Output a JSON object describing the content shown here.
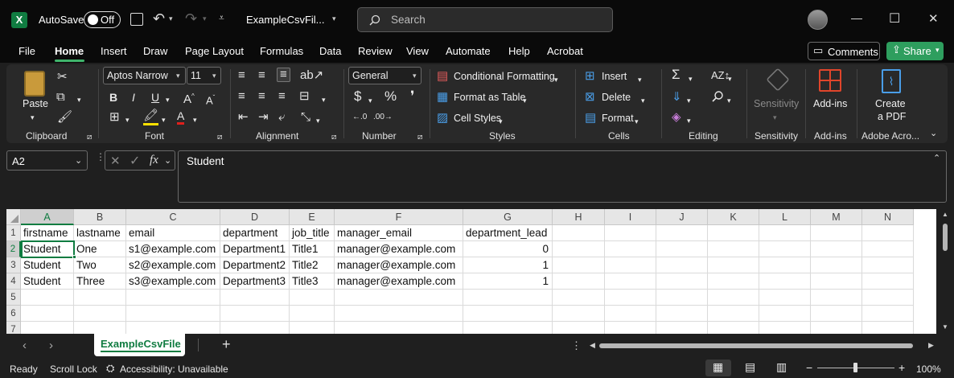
{
  "title": {
    "autosave_label": "AutoSave",
    "autosave_state": "Off",
    "filename": "ExampleCsvFil...",
    "search_placeholder": "Search",
    "minimize": "—",
    "maximize": "☐",
    "close": "✕"
  },
  "menu": {
    "tabs": [
      "File",
      "Home",
      "Insert",
      "Draw",
      "Page Layout",
      "Formulas",
      "Data",
      "Review",
      "View",
      "Automate",
      "Help",
      "Acrobat"
    ],
    "active": "Home",
    "comments": "Comments",
    "share": "Share"
  },
  "ribbon": {
    "clipboard": {
      "paste": "Paste",
      "label": "Clipboard"
    },
    "font": {
      "name": "Aptos Narrow",
      "size": "11",
      "label": "Font"
    },
    "alignment": {
      "label": "Alignment"
    },
    "number": {
      "format": "General",
      "label": "Number"
    },
    "styles": {
      "conditional": "Conditional Formatting",
      "table": "Format as Table",
      "cell_styles": "Cell Styles",
      "label": "Styles"
    },
    "cells": {
      "insert": "Insert",
      "delete": "Delete",
      "format": "Format",
      "label": "Cells"
    },
    "editing": {
      "label": "Editing"
    },
    "sensitivity": {
      "button": "Sensitivity",
      "label": "Sensitivity"
    },
    "addins": {
      "button": "Add-ins",
      "label": "Add-ins"
    },
    "acrobat": {
      "button_line1": "Create",
      "button_line2": "a PDF",
      "label": "Adobe Acro..."
    }
  },
  "formula": {
    "namebox": "A2",
    "fx": "fx",
    "content": "Student"
  },
  "sheet": {
    "columns": [
      "A",
      "B",
      "C",
      "D",
      "E",
      "F",
      "G",
      "H",
      "I",
      "J",
      "K",
      "L",
      "M",
      "N"
    ],
    "rows": [
      "1",
      "2",
      "3",
      "4",
      "5",
      "6",
      "7"
    ],
    "data": [
      [
        "firstname",
        "lastname",
        "email",
        "department",
        "job_title",
        "manager_email",
        "department_lead"
      ],
      [
        "Student",
        "One",
        "s1@example.com",
        "Department1",
        "Title1",
        "manager@example.com",
        "0"
      ],
      [
        "Student",
        "Two",
        "s2@example.com",
        "Department2",
        "Title2",
        "manager@example.com",
        "1"
      ],
      [
        "Student",
        "Three",
        "s3@example.com",
        "Department3",
        "Title3",
        "manager@example.com",
        "1"
      ]
    ],
    "selected_cell": "A2"
  },
  "tabs": {
    "active_sheet": "ExampleCsvFile",
    "add": "+"
  },
  "status": {
    "ready": "Ready",
    "scroll_lock": "Scroll Lock",
    "accessibility": "Accessibility: Unavailable",
    "zoom": "100%",
    "zoom_minus": "−",
    "zoom_plus": "+"
  },
  "colors": {
    "excel_green": "#107c41",
    "share_green": "#2e9e5e",
    "window_bg": "#1f1f1f"
  }
}
